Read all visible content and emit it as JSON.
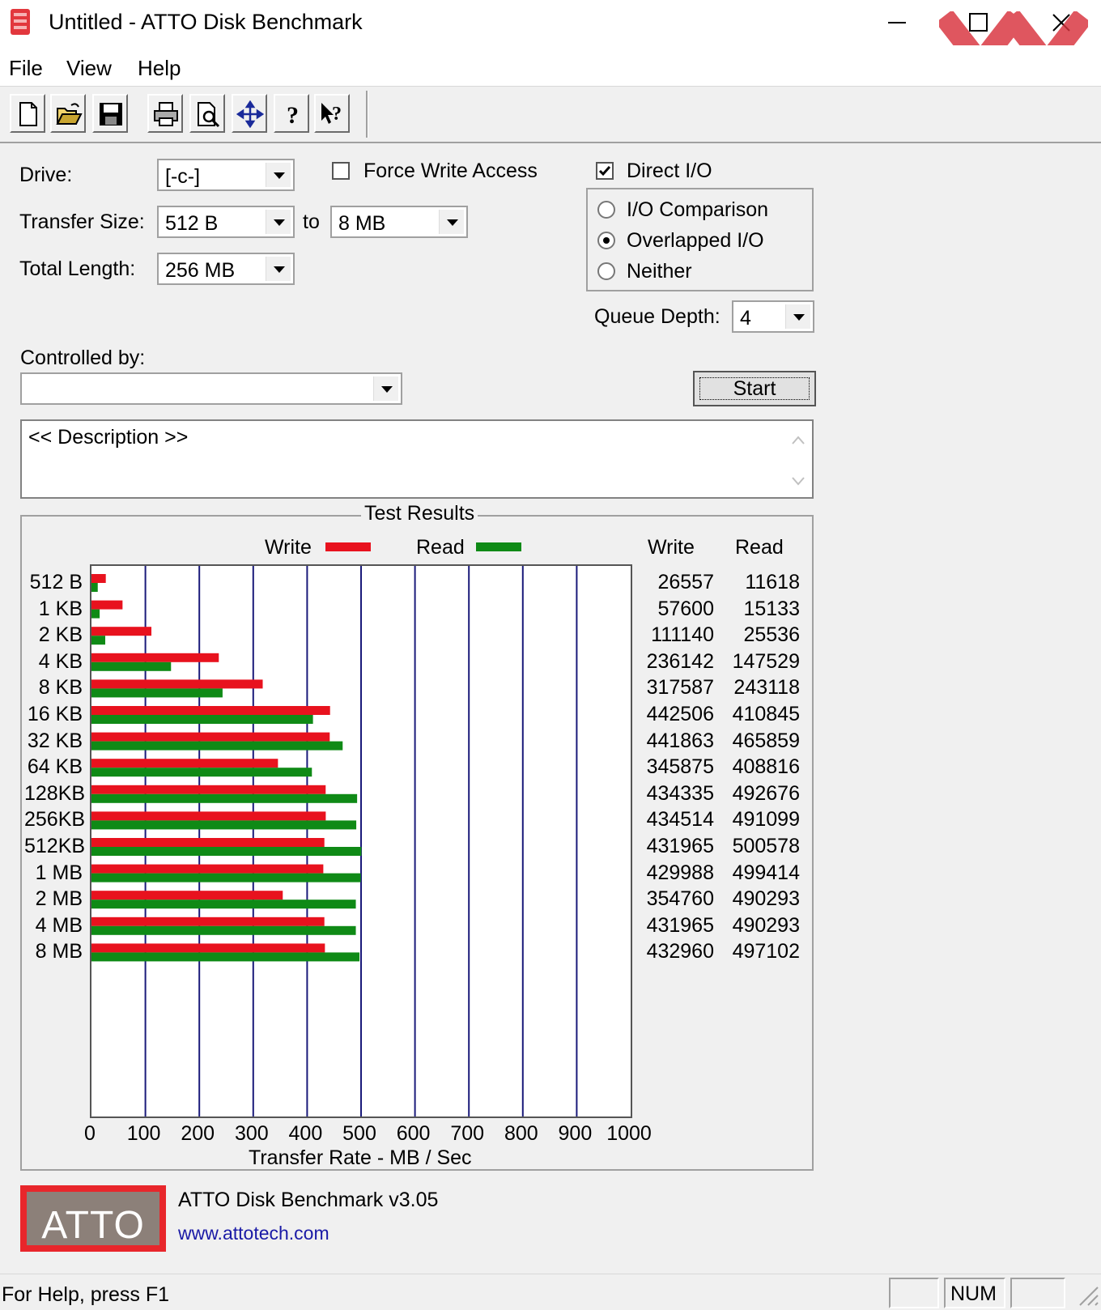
{
  "window": {
    "title": "Untitled - ATTO Disk Benchmark"
  },
  "menu": [
    "File",
    "View",
    "Help"
  ],
  "toolbar_icons": [
    "new-icon",
    "open-icon",
    "save-icon",
    "print-icon",
    "print-preview-icon",
    "move-icon",
    "help-icon",
    "context-help-icon"
  ],
  "form": {
    "drive_label": "Drive:",
    "drive_value": "[-c-]",
    "transfer_size_label": "Transfer Size:",
    "transfer_from": "512 B",
    "to_label": "to",
    "transfer_to": "8 MB",
    "total_length_label": "Total Length:",
    "total_length": "256 MB",
    "force_write_label": "Force Write Access",
    "force_write_checked": false,
    "direct_io_label": "Direct I/O",
    "direct_io_checked": true,
    "io_comparison_label": "I/O Comparison",
    "overlapped_io_label": "Overlapped I/O",
    "neither_label": "Neither",
    "selected_io_mode": "Overlapped I/O",
    "queue_depth_label": "Queue Depth:",
    "queue_depth": "4",
    "controlled_by_label": "Controlled by:",
    "controlled_by": "",
    "start_label": "Start",
    "description": "<< Description >>"
  },
  "results": {
    "group_title": "Test Results",
    "write_legend": "Write",
    "read_legend": "Read",
    "col_write": "Write",
    "col_read": "Read",
    "x_axis_label": "Transfer Rate - MB / Sec",
    "rows": [
      {
        "size": "512 B",
        "write": "26557",
        "read": "11618"
      },
      {
        "size": "1 KB",
        "write": "57600",
        "read": "15133"
      },
      {
        "size": "2 KB",
        "write": "111140",
        "read": "25536"
      },
      {
        "size": "4 KB",
        "write": "236142",
        "read": "147529"
      },
      {
        "size": "8 KB",
        "write": "317587",
        "read": "243118"
      },
      {
        "size": "16 KB",
        "write": "442506",
        "read": "410845"
      },
      {
        "size": "32 KB",
        "write": "441863",
        "read": "465859"
      },
      {
        "size": "64 KB",
        "write": "345875",
        "read": "408816"
      },
      {
        "size": "128KB",
        "write": "434335",
        "read": "492676"
      },
      {
        "size": "256KB",
        "write": "434514",
        "read": "491099"
      },
      {
        "size": "512KB",
        "write": "431965",
        "read": "500578"
      },
      {
        "size": "1 MB",
        "write": "429988",
        "read": "499414"
      },
      {
        "size": "2 MB",
        "write": "354760",
        "read": "490293"
      },
      {
        "size": "4 MB",
        "write": "431965",
        "read": "490293"
      },
      {
        "size": "8 MB",
        "write": "432960",
        "read": "497102"
      }
    ]
  },
  "chart_data": {
    "type": "bar",
    "orientation": "horizontal",
    "categories": [
      "512 B",
      "1 KB",
      "2 KB",
      "4 KB",
      "8 KB",
      "16 KB",
      "32 KB",
      "64 KB",
      "128KB",
      "256KB",
      "512KB",
      "1 MB",
      "2 MB",
      "4 MB",
      "8 MB"
    ],
    "series": [
      {
        "name": "Write",
        "color": "#e8121e",
        "values": [
          26557,
          57600,
          111140,
          236142,
          317587,
          442506,
          441863,
          345875,
          434335,
          434514,
          431965,
          429988,
          354760,
          431965,
          432960
        ]
      },
      {
        "name": "Read",
        "color": "#0f8a16",
        "values": [
          11618,
          15133,
          25536,
          147529,
          243118,
          410845,
          465859,
          408816,
          492676,
          491099,
          500578,
          499414,
          490293,
          490293,
          497102
        ]
      }
    ],
    "xlabel": "Transfer Rate - MB / Sec",
    "xlim": [
      0,
      1000
    ],
    "xticks": [
      "0",
      "100",
      "200",
      "300",
      "400",
      "500",
      "600",
      "700",
      "800",
      "900",
      "1000"
    ],
    "grid": true,
    "legend": "top"
  },
  "footer": {
    "logo_text": "ATTO",
    "version": "ATTO Disk Benchmark v3.05",
    "url": "www.attotech.com"
  },
  "status": {
    "help": "For Help, press F1",
    "num": "NUM"
  },
  "colors": {
    "accent_red": "#e8121e",
    "read_green": "#0f8a16",
    "grid_blue": "#1a1a7a",
    "link_blue": "#1a1aa6"
  }
}
